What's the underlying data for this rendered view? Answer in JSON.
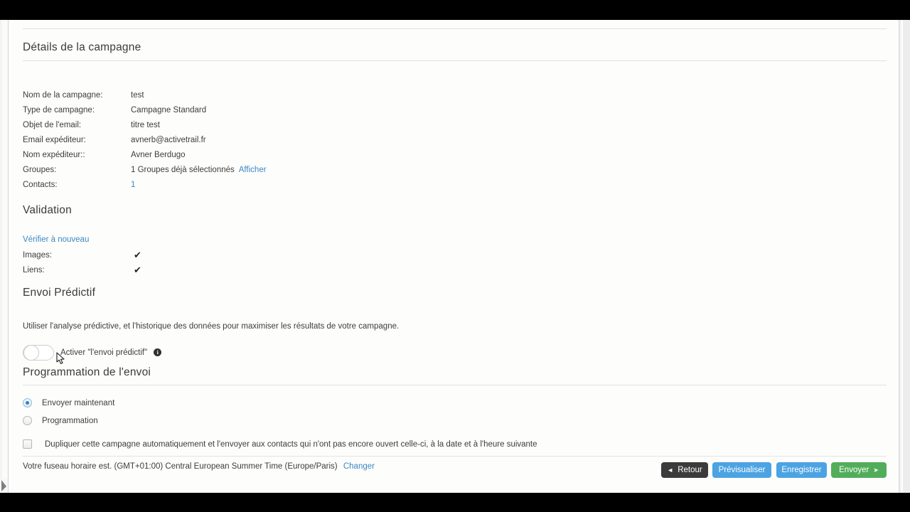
{
  "sections": {
    "details_title": "Détails de la campagne",
    "validation_title": "Validation",
    "predictive_title": "Envoi Prédictif",
    "schedule_title": "Programmation de l'envoi"
  },
  "details": [
    {
      "label": "Nom de la campagne:",
      "value": "test"
    },
    {
      "label": "Type de campagne:",
      "value": "Campagne Standard"
    },
    {
      "label": "Objet de l'email:",
      "value": "titre test"
    },
    {
      "label": "Email expéditeur:",
      "value": "avnerb@activetrail.fr"
    },
    {
      "label": "Nom expéditeur::",
      "value": "Avner Berdugo"
    },
    {
      "label": "Groupes:",
      "value": "1 Groupes déjà sélectionnés",
      "link": "Afficher"
    },
    {
      "label": "Contacts:",
      "value": "",
      "link": "1"
    }
  ],
  "validation": {
    "reverify_link": "Vérifier à nouveau",
    "rows": [
      {
        "label": "Images:",
        "status": "✔"
      },
      {
        "label": "Liens:",
        "status": "✔"
      }
    ]
  },
  "predictive": {
    "description": "Utiliser l'analyse prédictive, et l'historique des données pour maximiser les résultats de votre campagne.",
    "toggle_label": "Activer \"l'envoi prédictif\"",
    "toggle_state": "off",
    "info_glyph": "i"
  },
  "schedule": {
    "options": [
      {
        "label": "Envoyer maintenant",
        "selected": true
      },
      {
        "label": "Programmation",
        "selected": false
      }
    ],
    "duplicate_label": "Dupliquer cette campagne automatiquement et l'envoyer aux contacts qui n'ont pas encore ouvert celle-ci, à la date et à l'heure suivante",
    "duplicate_checked": false,
    "timezone_text": "Votre fuseau horaire est. (GMT+01:00) Central European Summer Time (Europe/Paris)",
    "timezone_change_link": "Changer"
  },
  "buttons": {
    "back": "Retour",
    "back_arrow": "◄",
    "preview": "Prévisualiser",
    "save": "Enregistrer",
    "send": "Envoyer",
    "send_arrow": "➤"
  },
  "colors": {
    "link": "#3b88c3",
    "primary_blue": "#4ba3e3",
    "send_green": "#52ad5b",
    "back_dark": "#3b3b3b",
    "radio_dot": "#3b7fc4"
  }
}
